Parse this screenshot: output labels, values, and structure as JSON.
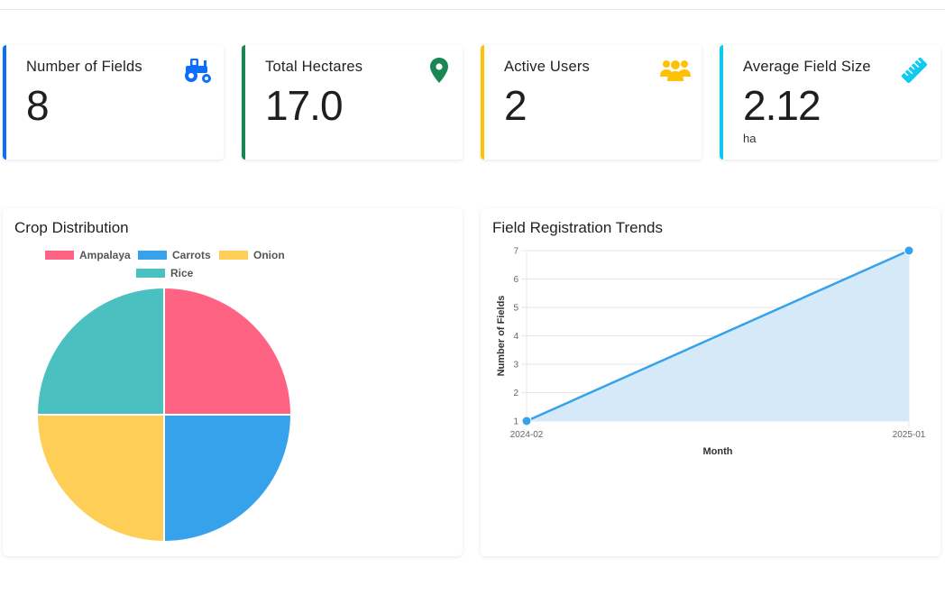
{
  "stats": [
    {
      "label": "Number of Fields",
      "value": "8",
      "unit": "",
      "color": "#0d6efd",
      "icon": "tractor-icon"
    },
    {
      "label": "Total Hectares",
      "value": "17.0",
      "unit": "",
      "color": "#198754",
      "icon": "map-marker-icon"
    },
    {
      "label": "Active Users",
      "value": "2",
      "unit": "",
      "color": "#ffc107",
      "icon": "users-icon"
    },
    {
      "label": "Average Field Size",
      "value": "2.12",
      "unit": "ha",
      "color": "#0dcaf0",
      "icon": "ruler-icon"
    }
  ],
  "pie_panel": {
    "title": "Crop Distribution",
    "legend": [
      {
        "label": "Ampalaya",
        "color": "#ff6384"
      },
      {
        "label": "Carrots",
        "color": "#36a2eb"
      },
      {
        "label": "Onion",
        "color": "#ffce56"
      },
      {
        "label": "Rice",
        "color": "#4bc0c0"
      }
    ]
  },
  "line_panel": {
    "title": "Field Registration Trends"
  },
  "chart_data": [
    {
      "type": "pie",
      "categories": [
        "Ampalaya",
        "Carrots",
        "Onion",
        "Rice"
      ],
      "values": [
        2,
        2,
        2,
        2
      ],
      "colors": [
        "#ff6384",
        "#36a2eb",
        "#ffce56",
        "#4bc0c0"
      ],
      "legend": "top"
    },
    {
      "type": "area",
      "x": [
        "2024-02",
        "2025-01"
      ],
      "values": [
        1,
        7
      ],
      "xlabel": "Month",
      "ylabel": "Number of Fields",
      "ylim": [
        1,
        7
      ],
      "yticks": [
        1,
        2,
        3,
        4,
        5,
        6,
        7
      ],
      "line_color": "#36a2eb",
      "fill_color": "#d6e9f8",
      "grid": true
    }
  ]
}
